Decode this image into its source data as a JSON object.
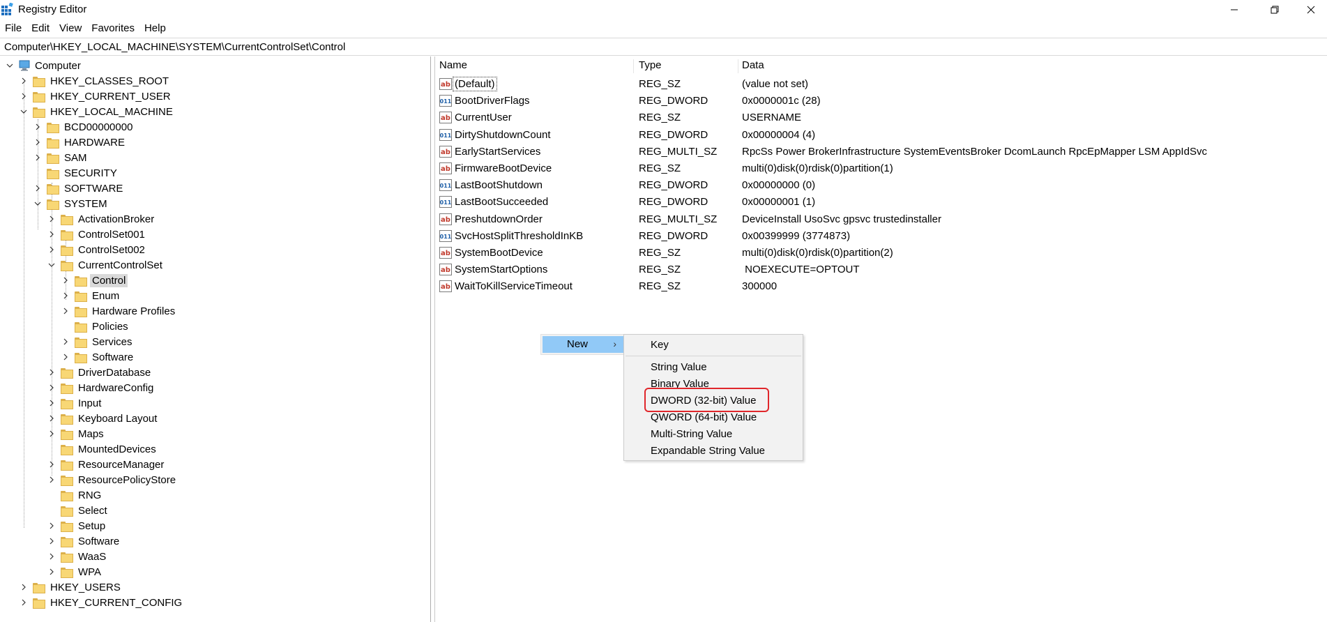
{
  "window": {
    "title": "Registry Editor",
    "icon": "regedit-icon",
    "controls": [
      "minimize-icon",
      "maximize-icon",
      "close-icon"
    ]
  },
  "menubar": [
    "File",
    "Edit",
    "View",
    "Favorites",
    "Help"
  ],
  "address": "Computer\\HKEY_LOCAL_MACHINE\\SYSTEM\\CurrentControlSet\\Control",
  "tree": {
    "root": "Computer",
    "hklm_children": {
      "bcd": "BCD00000000",
      "hardware": "HARDWARE",
      "sam": "SAM",
      "security": "SECURITY",
      "software": "SOFTWARE",
      "system": "SYSTEM"
    },
    "hives": {
      "classes_root": "HKEY_CLASSES_ROOT",
      "current_user": "HKEY_CURRENT_USER",
      "local_machine": "HKEY_LOCAL_MACHINE",
      "users": "HKEY_USERS",
      "current_config": "HKEY_CURRENT_CONFIG"
    },
    "system_children": {
      "activationbroker": "ActivationBroker",
      "controlset001": "ControlSet001",
      "controlset002": "ControlSet002",
      "currentcontrolset": "CurrentControlSet",
      "driverdatabase": "DriverDatabase",
      "hardwareconfig": "HardwareConfig",
      "input": "Input",
      "keyboardlayout": "Keyboard Layout",
      "maps": "Maps",
      "mounteddevices": "MountedDevices",
      "resourcemanager": "ResourceManager",
      "resourcepolicystore": "ResourcePolicyStore",
      "rng": "RNG",
      "select": "Select",
      "setup": "Setup",
      "software": "Software",
      "waas": "WaaS",
      "wpa": "WPA"
    },
    "ccs_children": {
      "control": "Control",
      "enum": "Enum",
      "hardwareprofiles": "Hardware Profiles",
      "policies": "Policies",
      "services": "Services",
      "software": "Software"
    },
    "selected": "Control"
  },
  "list": {
    "columns": {
      "name": "Name",
      "type": "Type",
      "data": "Data"
    },
    "rows": [
      {
        "name": "(Default)",
        "type": "REG_SZ",
        "data": "(value not set)",
        "icon": "string-value-icon"
      },
      {
        "name": "BootDriverFlags",
        "type": "REG_DWORD",
        "data": "0x0000001c (28)",
        "icon": "binary-value-icon"
      },
      {
        "name": "CurrentUser",
        "type": "REG_SZ",
        "data": "USERNAME",
        "icon": "string-value-icon"
      },
      {
        "name": "DirtyShutdownCount",
        "type": "REG_DWORD",
        "data": "0x00000004 (4)",
        "icon": "binary-value-icon"
      },
      {
        "name": "EarlyStartServices",
        "type": "REG_MULTI_SZ",
        "data": "RpcSs Power BrokerInfrastructure SystemEventsBroker DcomLaunch RpcEpMapper LSM AppIdSvc",
        "icon": "string-value-icon"
      },
      {
        "name": "FirmwareBootDevice",
        "type": "REG_SZ",
        "data": "multi(0)disk(0)rdisk(0)partition(1)",
        "icon": "string-value-icon"
      },
      {
        "name": "LastBootShutdown",
        "type": "REG_DWORD",
        "data": "0x00000000 (0)",
        "icon": "binary-value-icon"
      },
      {
        "name": "LastBootSucceeded",
        "type": "REG_DWORD",
        "data": "0x00000001 (1)",
        "icon": "binary-value-icon"
      },
      {
        "name": "PreshutdownOrder",
        "type": "REG_MULTI_SZ",
        "data": "DeviceInstall UsoSvc gpsvc trustedinstaller",
        "icon": "string-value-icon"
      },
      {
        "name": "SvcHostSplitThresholdInKB",
        "type": "REG_DWORD",
        "data": "0x00399999 (3774873)",
        "icon": "binary-value-icon"
      },
      {
        "name": "SystemBootDevice",
        "type": "REG_SZ",
        "data": "multi(0)disk(0)rdisk(0)partition(2)",
        "icon": "string-value-icon"
      },
      {
        "name": "SystemStartOptions",
        "type": "REG_SZ",
        "data": " NOEXECUTE=OPTOUT",
        "icon": "string-value-icon"
      },
      {
        "name": "WaitToKillServiceTimeout",
        "type": "REG_SZ",
        "data": "300000",
        "icon": "string-value-icon"
      }
    ]
  },
  "context_menu": {
    "new_label": "New",
    "submenu": {
      "key": "Key",
      "string": "String Value",
      "binary": "Binary Value",
      "dword": "DWORD (32-bit) Value",
      "qword": "QWORD (64-bit) Value",
      "multistring": "Multi-String Value",
      "expandable": "Expandable String Value"
    },
    "highlighted": "DWORD (32-bit) Value",
    "highlight_color": "#e0262b"
  }
}
